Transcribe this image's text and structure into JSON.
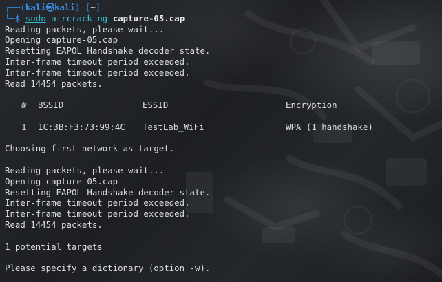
{
  "prompt": {
    "user": "kali",
    "host": "kali",
    "cwd": "~",
    "sudo": "sudo",
    "command": "aircrack-ng",
    "argument": "capture-05.cap"
  },
  "output_block_1": [
    "Reading packets, please wait...",
    "Opening capture-05.cap",
    "Resetting EAPOL Handshake decoder state.",
    "Inter-frame timeout period exceeded.",
    "Inter-frame timeout period exceeded.",
    "Read 14454 packets."
  ],
  "table": {
    "headers": [
      "#",
      "BSSID",
      "ESSID",
      "Encryption"
    ],
    "rows": [
      [
        "1",
        "1C:3B:F3:73:99:4C",
        "TestLab_WiFi",
        "WPA (1 handshake)"
      ]
    ]
  },
  "choosing": "Choosing first network as target.",
  "output_block_2": [
    "Reading packets, please wait...",
    "Opening capture-05.cap",
    "Resetting EAPOL Handshake decoder state.",
    "Inter-frame timeout period exceeded.",
    "Inter-frame timeout period exceeded.",
    "Read 14454 packets."
  ],
  "targets": "1 potential targets",
  "final": "Please specify a dictionary (option -w).",
  "colors": {
    "prompt_box": "#2f86d4",
    "prompt_user": "#3b8ee6",
    "command": "#39c7d6",
    "text": "#dcdcdc",
    "background": "#1f2125"
  }
}
